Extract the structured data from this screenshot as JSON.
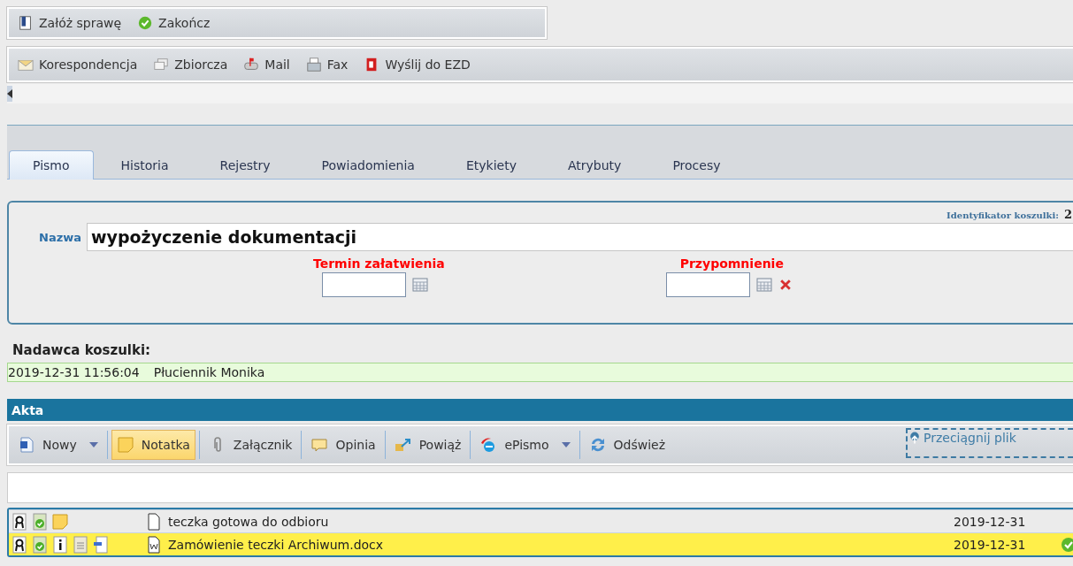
{
  "top_toolbar": [
    {
      "label": "Załóż sprawę"
    },
    {
      "label": "Zakończ"
    }
  ],
  "send_toolbar": [
    {
      "label": "Korespondencja"
    },
    {
      "label": "Zbiorcza"
    },
    {
      "label": "Mail"
    },
    {
      "label": "Fax"
    },
    {
      "label": "Wyślij do EZD"
    }
  ],
  "tabs": [
    {
      "label": "Pismo",
      "selected": true
    },
    {
      "label": "Historia",
      "selected": false
    },
    {
      "label": "Rejestry",
      "selected": false
    },
    {
      "label": "Powiadomienia",
      "selected": false
    },
    {
      "label": "Etykiety",
      "selected": false
    },
    {
      "label": "Atrybuty",
      "selected": false
    },
    {
      "label": "Procesy",
      "selected": false
    }
  ],
  "form": {
    "identifier_label": "Identyfikator koszulki:",
    "identifier_value": "2",
    "name_label": "Nazwa",
    "name_value": "wypożyczenie dokumentacji",
    "due_label": "Termin załatwienia",
    "reminder_label": "Przypomnienie"
  },
  "sender": {
    "title": "Nadawca koszulki:",
    "date": "2019-12-31 11:56:04",
    "name": "Płuciennik Monika"
  },
  "files": {
    "title": "Akta",
    "toolbar": [
      {
        "label": "Nowy",
        "dropdown": true,
        "selected": false
      },
      {
        "label": "Notatka",
        "dropdown": false,
        "selected": true
      },
      {
        "label": "Załącznik",
        "dropdown": false,
        "selected": false
      },
      {
        "label": "Opinia",
        "dropdown": false,
        "selected": false
      },
      {
        "label": "Powiąż",
        "dropdown": false,
        "selected": false
      },
      {
        "label": "ePismo",
        "dropdown": true,
        "selected": false
      },
      {
        "label": "Odśwież",
        "dropdown": false,
        "selected": false
      }
    ],
    "drop_zone": "Przeciągnij plik",
    "rows": [
      {
        "selected": false,
        "name": "teczka gotowa do odbioru",
        "date": "2019-12-31"
      },
      {
        "selected": true,
        "name": "Zamówienie teczki Archiwum.docx",
        "date": "2019-12-31"
      }
    ]
  }
}
